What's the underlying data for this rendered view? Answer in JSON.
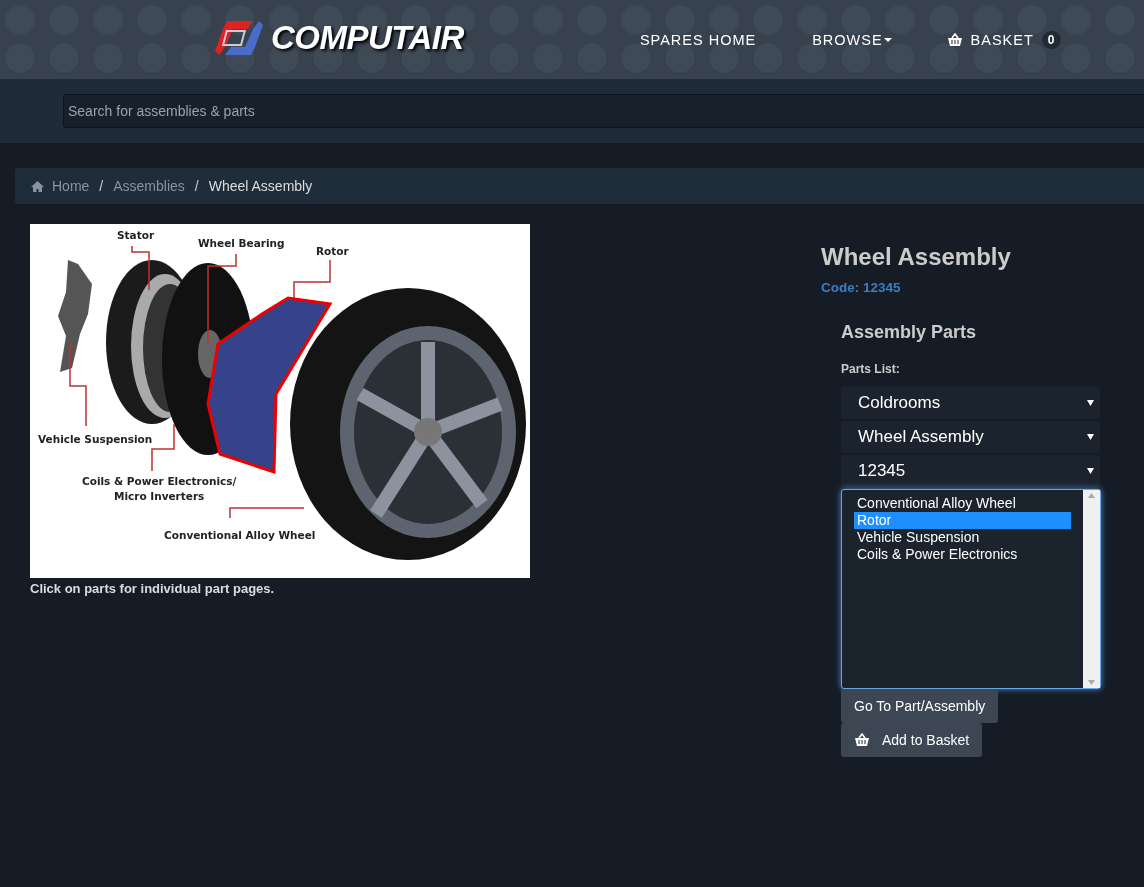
{
  "header": {
    "logo": "COMPUTAIR",
    "nav": [
      {
        "label": "SPARES HOME",
        "kind": "link"
      },
      {
        "label": "BROWSE",
        "kind": "dropdown"
      },
      {
        "label": "BASKET",
        "kind": "basket",
        "count": "0"
      }
    ]
  },
  "search": {
    "placeholder": "Search for assemblies & parts"
  },
  "breadcrumb": {
    "separator": "/",
    "items": [
      {
        "label": "Home",
        "kind": "home"
      },
      {
        "label": "Assemblies",
        "kind": "link"
      },
      {
        "label": "Wheel Assembly",
        "kind": "current"
      }
    ]
  },
  "diagram": {
    "labels": [
      "Stator",
      "Wheel Bearing",
      "Rotor",
      "Vehicle Suspension",
      "Coils & Power Electronics/\nMicro Inverters",
      "Conventional Alloy Wheel"
    ],
    "caption": "Click on parts for individual part pages."
  },
  "product": {
    "title": "Wheel Assembly",
    "code": "Code: 12345"
  },
  "parts": {
    "heading": "Assembly Parts",
    "label": "Parts List:",
    "dropdowns": [
      "Coldrooms",
      "Wheel Assembly",
      "12345"
    ],
    "items": [
      {
        "label": "Conventional Alloy Wheel",
        "selected": false
      },
      {
        "label": "Rotor",
        "selected": true
      },
      {
        "label": "Vehicle Suspension",
        "selected": false
      },
      {
        "label": "Coils & Power Electronics",
        "selected": false
      }
    ],
    "buttons": [
      {
        "label": "Go To Part/Assembly",
        "kind": "plain"
      },
      {
        "label": "Add to Basket",
        "kind": "basket"
      }
    ]
  }
}
